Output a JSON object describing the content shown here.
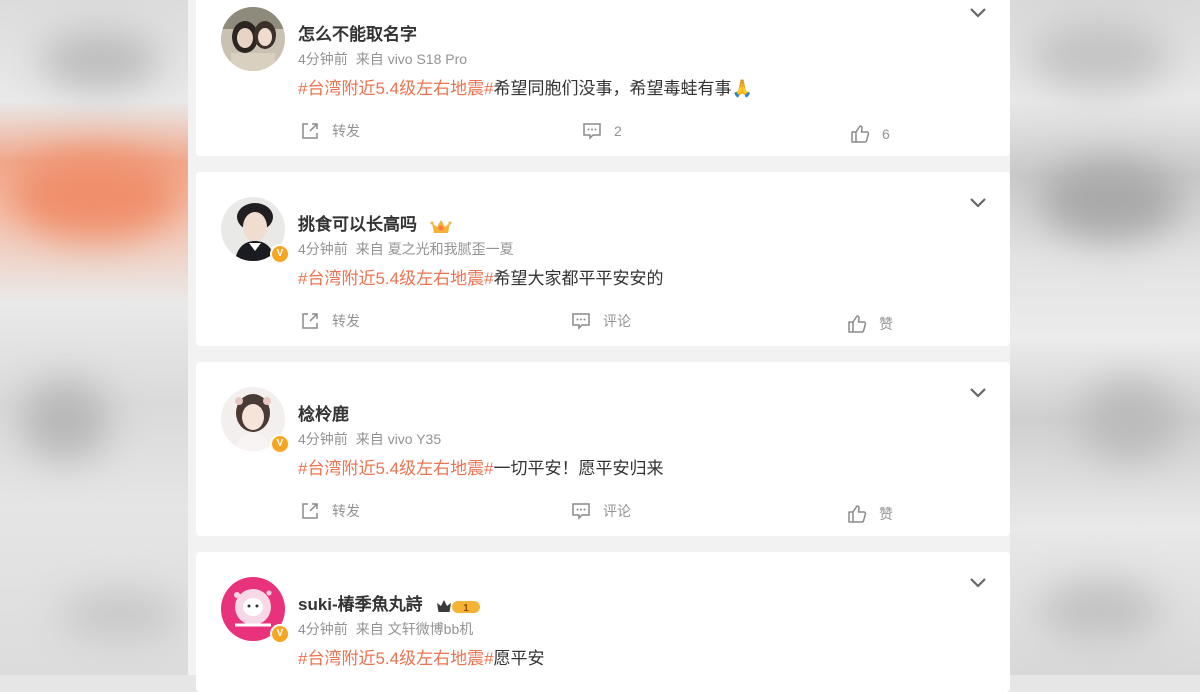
{
  "topic": "#台湾附近5.4级左右地震#",
  "labels": {
    "from": "来自"
  },
  "posts": [
    {
      "username": "怎么不能取名字",
      "time": "4分钟前",
      "source": "vivo S18 Pro",
      "text": "希望同胞们没事，希望毒蛙有事🙏",
      "repost_label": "转发",
      "comment_label": "2",
      "like_label": "6",
      "verified": false
    },
    {
      "username": "挑食可以长高吗",
      "time": "4分钟前",
      "source": "夏之光和我腻歪一夏",
      "text": "希望大家都平平安安的",
      "repost_label": "转发",
      "comment_label": "评论",
      "like_label": "赞",
      "verified": true
    },
    {
      "username": "棯柃鹿",
      "time": "4分钟前",
      "source": "vivo Y35",
      "text": "一切平安！愿平安归来",
      "repost_label": "转发",
      "comment_label": "评论",
      "like_label": "赞",
      "verified": true
    },
    {
      "username": "suki-椿季魚丸詩",
      "time": "4分钟前",
      "source": "文轩微博bb机",
      "text": "愿平安",
      "verified": true,
      "vip_level": "1"
    }
  ],
  "colors": {
    "topic": "#eb7350",
    "verified_badge": "#f6a623",
    "meta": "#939393"
  }
}
